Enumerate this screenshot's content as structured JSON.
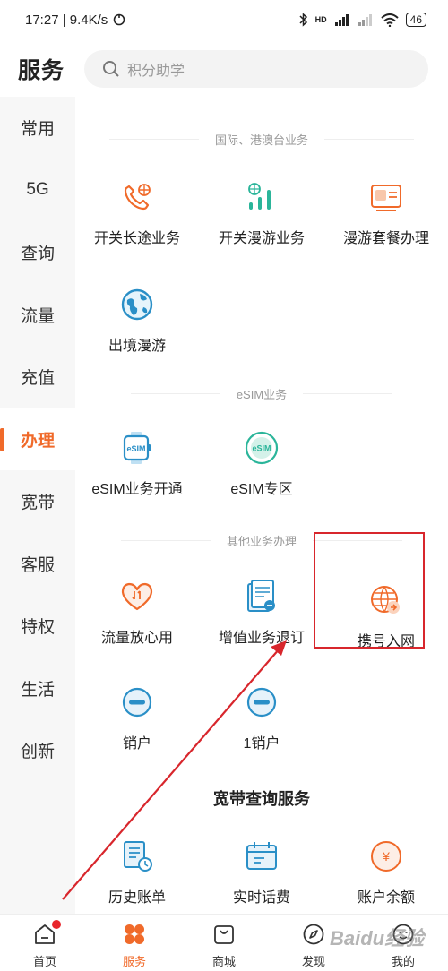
{
  "status_bar": {
    "time_speed": "17:27 | 9.4K/s",
    "network": "HD",
    "battery": "46"
  },
  "header": {
    "title": "服务",
    "search_placeholder": "积分助学"
  },
  "sidebar": {
    "items": [
      {
        "label": "常用"
      },
      {
        "label": "5G"
      },
      {
        "label": "查询"
      },
      {
        "label": "流量"
      },
      {
        "label": "充值"
      },
      {
        "label": "办理"
      },
      {
        "label": "宽带"
      },
      {
        "label": "客服"
      },
      {
        "label": "特权"
      },
      {
        "label": "生活"
      },
      {
        "label": "创新"
      }
    ],
    "active_index": 5
  },
  "sections": {
    "intl": {
      "title": "国际、港澳台业务",
      "items": [
        {
          "label": "开关长途业务",
          "icon": "phone-globe-icon"
        },
        {
          "label": "开关漫游业务",
          "icon": "globe-bars-icon"
        },
        {
          "label": "漫游套餐办理",
          "icon": "roaming-package-icon"
        },
        {
          "label": "出境漫游",
          "icon": "earth-icon"
        }
      ]
    },
    "esim": {
      "title": "eSIM业务",
      "items": [
        {
          "label": "eSIM业务开通",
          "icon": "esim-watch-icon",
          "badge": "eSIM"
        },
        {
          "label": "eSIM专区",
          "icon": "esim-circle-icon",
          "badge": "eSIM"
        }
      ]
    },
    "other": {
      "title": "其他业务办理",
      "items": [
        {
          "label": "流量放心用",
          "icon": "heart-data-icon"
        },
        {
          "label": "增值业务退订",
          "icon": "unsubscribe-doc-icon"
        },
        {
          "label": "携号入网",
          "icon": "number-portability-icon"
        },
        {
          "label": "销户",
          "icon": "minus-circle-icon"
        },
        {
          "label": "1销户",
          "icon": "minus-circle-icon"
        }
      ]
    },
    "broadband": {
      "title": "宽带查询服务",
      "items": [
        {
          "label": "历史账单",
          "icon": "bill-history-icon"
        },
        {
          "label": "实时话费",
          "icon": "realtime-fee-icon"
        },
        {
          "label": "账户余额",
          "icon": "yen-balance-icon",
          "symbol": "¥"
        }
      ]
    }
  },
  "bottom_nav": {
    "items": [
      {
        "label": "首页",
        "icon": "home-icon"
      },
      {
        "label": "服务",
        "icon": "service-grid-icon"
      },
      {
        "label": "商城",
        "icon": "shop-bag-icon"
      },
      {
        "label": "发现",
        "icon": "compass-icon"
      },
      {
        "label": "我的",
        "icon": "profile-icon"
      }
    ],
    "active_index": 1
  },
  "watermark": "Baidu经验",
  "colors": {
    "accent": "#f06a2a",
    "teal": "#2bb59a",
    "annotation": "#d8262c"
  }
}
